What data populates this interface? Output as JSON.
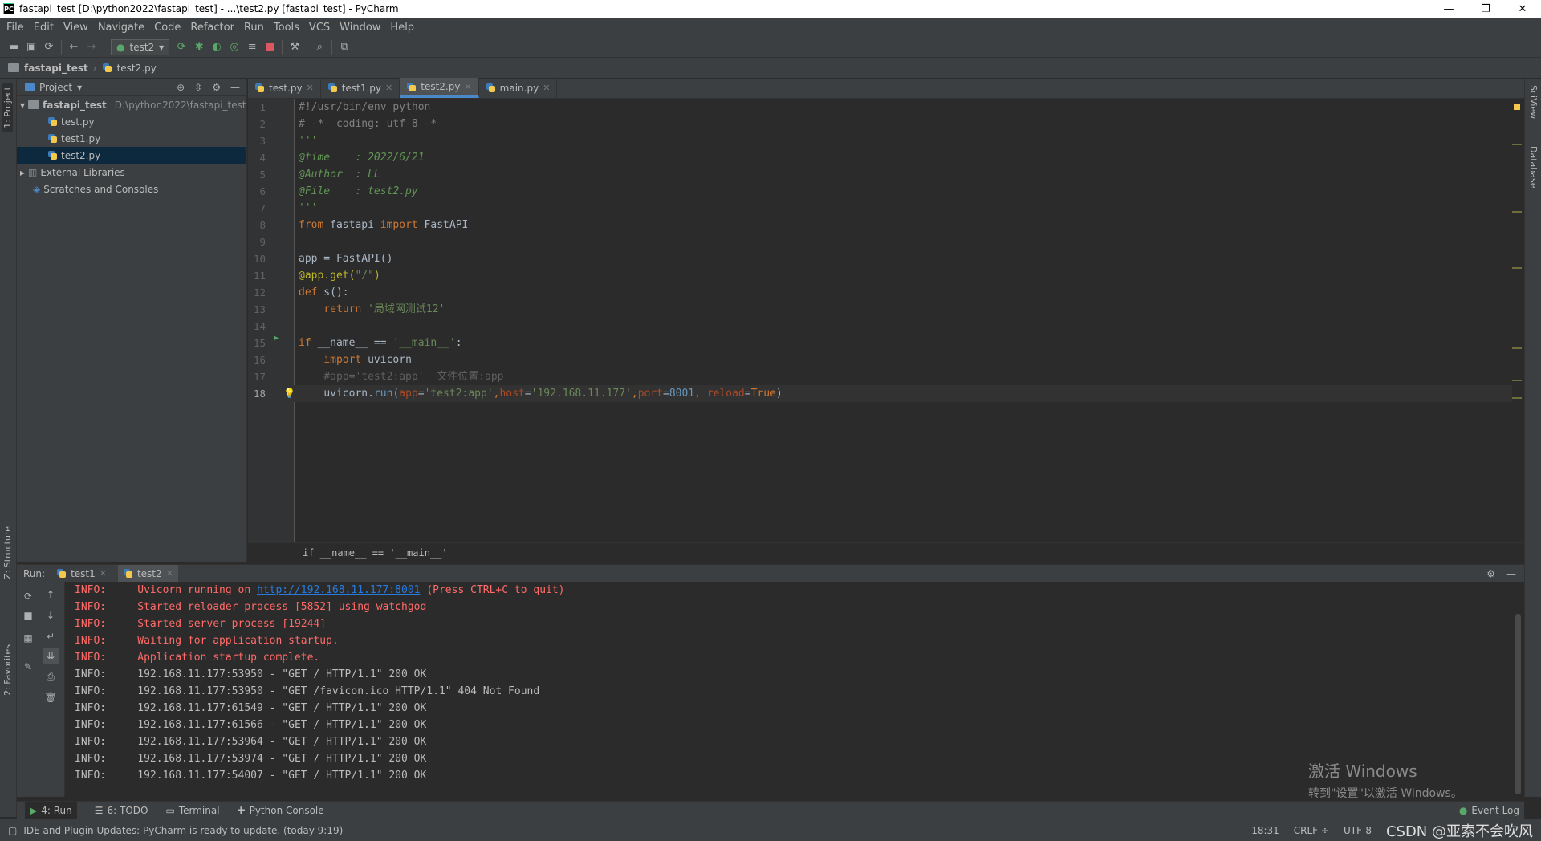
{
  "window": {
    "title": "fastapi_test [D:\\python2022\\fastapi_test] - ...\\test2.py [fastapi_test] - PyCharm",
    "logo": "PC",
    "minimize": "—",
    "restore": "❐",
    "close": "✕"
  },
  "menu": [
    "File",
    "Edit",
    "View",
    "Navigate",
    "Code",
    "Refactor",
    "Run",
    "Tools",
    "VCS",
    "Window",
    "Help"
  ],
  "toolbar": {
    "run_config": "test2"
  },
  "navbar": {
    "root": "fastapi_test",
    "file": "test2.py"
  },
  "left_strip": {
    "project": "1: Project",
    "structure": "Z: Structure",
    "favorites": "2: Favorites"
  },
  "right_strip": {
    "sciview": "SciView",
    "database": "Database"
  },
  "project_panel": {
    "header": "Project",
    "tree": [
      {
        "label": "fastapi_test",
        "path": "D:\\python2022\\fastapi_test"
      },
      {
        "label": "test.py"
      },
      {
        "label": "test1.py"
      },
      {
        "label": "test2.py"
      },
      {
        "label": "External Libraries"
      },
      {
        "label": "Scratches and Consoles"
      }
    ]
  },
  "editor": {
    "tabs": [
      "test.py",
      "test1.py",
      "test2.py",
      "main.py"
    ],
    "active_tab": "test2.py",
    "line_numbers": [
      "1",
      "2",
      "3",
      "4",
      "5",
      "6",
      "7",
      "8",
      "9",
      "10",
      "11",
      "12",
      "13",
      "14",
      "15",
      "16",
      "17",
      "18"
    ],
    "code": {
      "l1": "#!/usr/bin/env python",
      "l2": "# -*- coding: utf-8 -*-",
      "l3": "'''",
      "l4": "@time    : 2022/6/21",
      "l5": "@Author  : LL",
      "l6": "@File    : test2.py",
      "l7": "'''",
      "l8_kw1": "from",
      "l8_mod": " fastapi ",
      "l8_kw2": "import",
      "l8_name": " FastAPI",
      "l10": "app = FastAPI()",
      "l11_dec": "@app.get(",
      "l11_str": "\"/\"",
      "l11_end": ")",
      "l12_kw": "def",
      "l12_rest": " s():",
      "l13_kw": "return",
      "l13_str": "'局域网测试12'",
      "l15_kw": "if",
      "l15_mid": " __name__ == ",
      "l15_str": "'__main__'",
      "l15_end": ":",
      "l16_kw": "import",
      "l16_rest": " uvicorn",
      "l17": "#app='test2:app'  文件位置:app",
      "l18_obj": "uvicorn.",
      "l18_fn": "run",
      "l18_p1": "app",
      "l18_s1": "'test2:app'",
      "l18_p2": "host",
      "l18_s2": "'192.168.11.177'",
      "l18_p3": "port",
      "l18_n": "8001",
      "l18_p4": "reload",
      "l18_kw": "True"
    },
    "breadcrumb": "if __name__ == '__main__'"
  },
  "run_panel": {
    "label": "Run:",
    "tabs": [
      "test1",
      "test2"
    ],
    "console": [
      {
        "level": "INFO:",
        "msg": "Uvicorn running on ",
        "link": "http://192.168.11.177:8001",
        "tail": " (Press CTRL+C to quit)"
      },
      {
        "level": "INFO:",
        "msg": "Started reloader process [5852] using watchgod"
      },
      {
        "level": "INFO:",
        "msg": "Started server process [19244]"
      },
      {
        "level": "INFO:",
        "msg": "Waiting for application startup."
      },
      {
        "level": "INFO:",
        "msg": "Application startup complete."
      },
      {
        "level": "INFO:",
        "msg": "192.168.11.177:53950 - \"GET / HTTP/1.1\" 200 OK"
      },
      {
        "level": "INFO:",
        "msg": "192.168.11.177:53950 - \"GET /favicon.ico HTTP/1.1\" 404 Not Found"
      },
      {
        "level": "INFO:",
        "msg": "192.168.11.177:61549 - \"GET / HTTP/1.1\" 200 OK"
      },
      {
        "level": "INFO:",
        "msg": "192.168.11.177:61566 - \"GET / HTTP/1.1\" 200 OK"
      },
      {
        "level": "INFO:",
        "msg": "192.168.11.177:53964 - \"GET / HTTP/1.1\" 200 OK"
      },
      {
        "level": "INFO:",
        "msg": "192.168.11.177:53974 - \"GET / HTTP/1.1\" 200 OK"
      },
      {
        "level": "INFO:",
        "msg": "192.168.11.177:54007 - \"GET / HTTP/1.1\" 200 OK"
      }
    ]
  },
  "watermark": {
    "line1": "激活 Windows",
    "line2": "转到\"设置\"以激活 Windows。"
  },
  "bottom_tools": {
    "run": "4: Run",
    "todo": "6: TODO",
    "terminal": "Terminal",
    "python_console": "Python Console",
    "event_log": "Event Log"
  },
  "status": {
    "message": "IDE and Plugin Updates: PyCharm is ready to update. (today 9:19)",
    "position": "18:31",
    "line_sep": "CRLF ÷",
    "encoding": "UTF-8",
    "csdn": "CSDN @亚索不会吹风"
  }
}
